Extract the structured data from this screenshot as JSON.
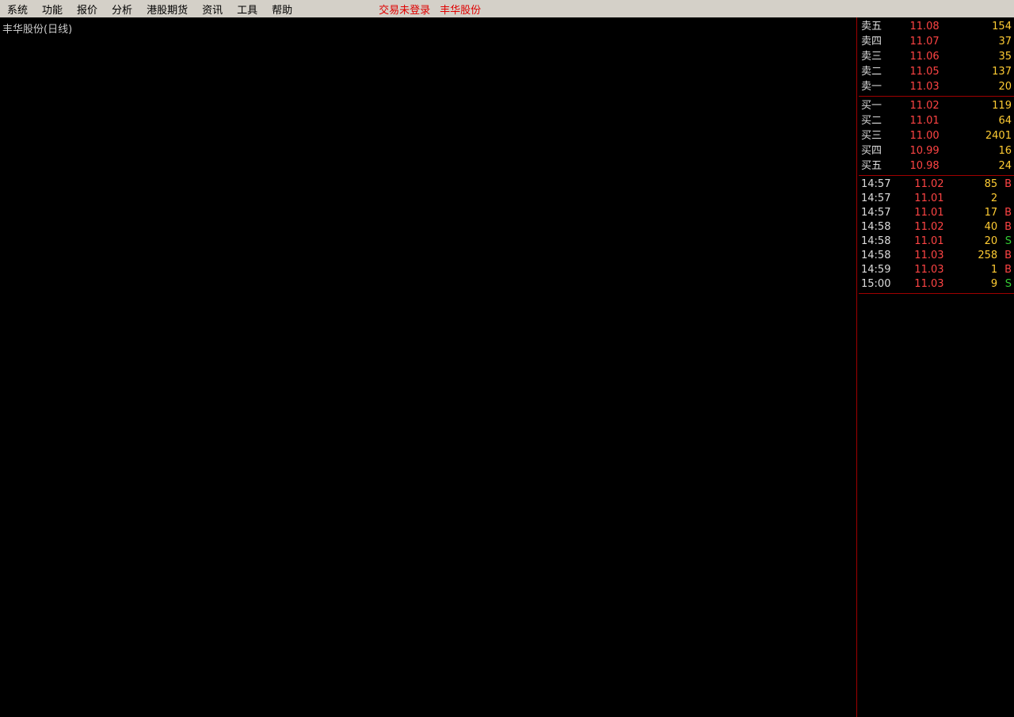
{
  "menu": {
    "items": [
      "系统",
      "功能",
      "报价",
      "分析",
      "港股期货",
      "资讯",
      "工具",
      "帮助"
    ],
    "status": "交易未登录",
    "stock": "丰华股份"
  },
  "chart": {
    "title": "丰华股份(日线)"
  },
  "book": {
    "sells": [
      [
        "卖五",
        "11.08",
        "154"
      ],
      [
        "卖四",
        "11.07",
        "37"
      ],
      [
        "卖三",
        "11.06",
        "35"
      ],
      [
        "卖二",
        "11.05",
        "137"
      ],
      [
        "卖一",
        "11.03",
        "20"
      ]
    ],
    "buys": [
      [
        "买一",
        "11.02",
        "119"
      ],
      [
        "买二",
        "11.01",
        "64"
      ],
      [
        "买三",
        "11.00",
        "2401"
      ],
      [
        "买四",
        "10.99",
        "16"
      ],
      [
        "买五",
        "10.98",
        "24"
      ]
    ]
  },
  "trades": [
    [
      "14:57",
      "11.02",
      "85",
      "B"
    ],
    [
      "14:57",
      "11.01",
      "2",
      ""
    ],
    [
      "14:57",
      "11.01",
      "17",
      "B"
    ],
    [
      "14:58",
      "11.02",
      "40",
      "B"
    ],
    [
      "14:58",
      "11.01",
      "20",
      "S"
    ],
    [
      "14:58",
      "11.03",
      "258",
      "B"
    ],
    [
      "14:59",
      "11.03",
      "1",
      "B"
    ],
    [
      "15:00",
      "11.03",
      "9",
      "S"
    ]
  ]
}
